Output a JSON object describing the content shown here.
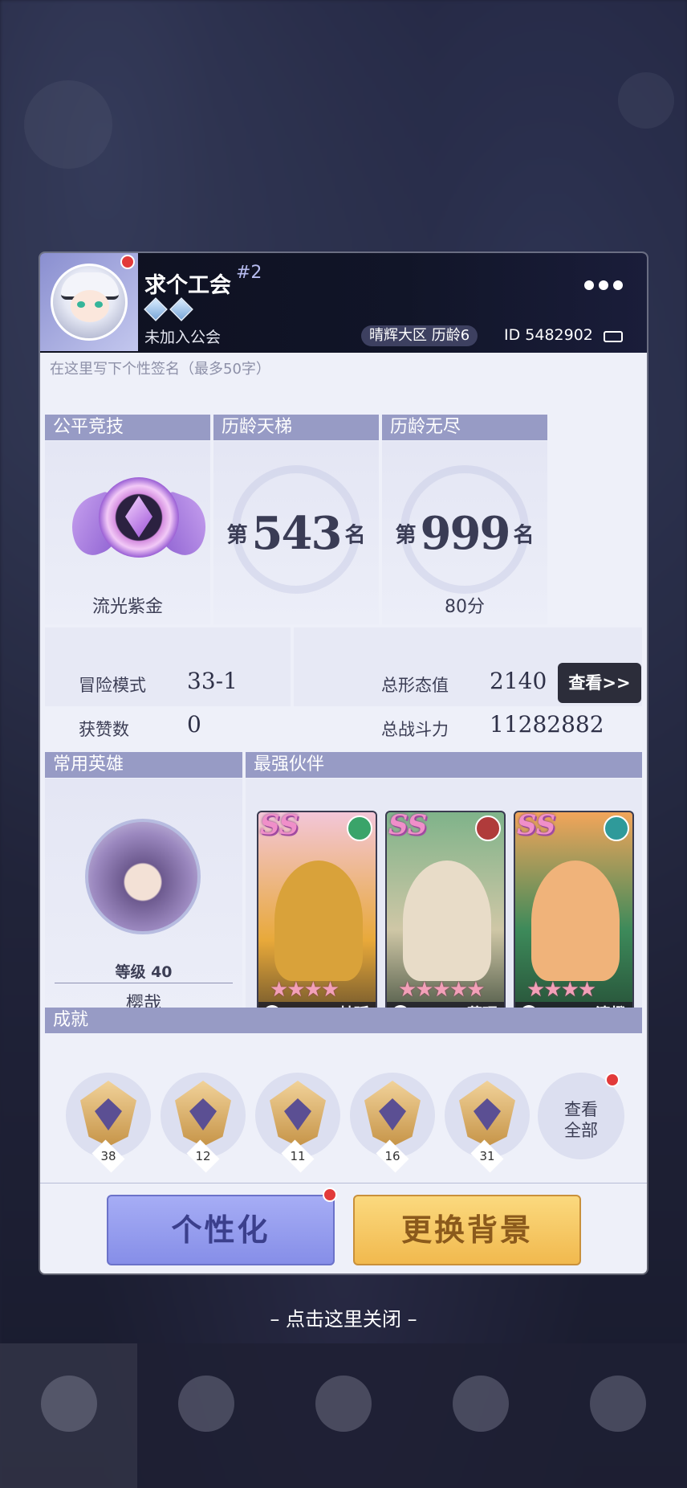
{
  "header": {
    "username": "求个工会",
    "rank_badge": "#2",
    "guild": "未加入公会",
    "region": "晴辉大区  历龄6",
    "player_id": "ID 5482902"
  },
  "signature_placeholder": "在这里写下个性签名（最多50字）",
  "sections": {
    "fair": {
      "title": "公平竞技",
      "rank_name": "流光紫金"
    },
    "ladder": {
      "title": "历龄天梯",
      "prefix": "第",
      "value": "543",
      "suffix": "名"
    },
    "endless": {
      "title": "历龄无尽",
      "prefix": "第",
      "value": "999",
      "suffix": "名",
      "score": "80分"
    }
  },
  "stats": {
    "adventure_label": "冒险模式",
    "adventure_value": "33-1",
    "likes_label": "获赞数",
    "likes_value": "0",
    "form_label": "总形态值",
    "form_value": "2140",
    "power_label": "总战斗力",
    "power_value": "11282882",
    "view_button": "查看>>"
  },
  "hero": {
    "title": "常用英雄",
    "level": "等级 40",
    "name": "樱哉"
  },
  "partners": {
    "title": "最强伙伴",
    "items": [
      {
        "grade": "SS",
        "name": "赫廷",
        "stars": "★★★★",
        "color": "#e8a93a"
      },
      {
        "grade": "SS",
        "name": "藏理",
        "stars": "★★★★★",
        "color": "#6f9d7a"
      },
      {
        "grade": "SS",
        "name": "清橙",
        "stars": "★★★★",
        "color": "#3d8a5a"
      }
    ]
  },
  "achievements": {
    "title": "成就",
    "items": [
      {
        "count": "38"
      },
      {
        "count": "12"
      },
      {
        "count": "11"
      },
      {
        "count": "16"
      },
      {
        "count": "31"
      }
    ],
    "view_all_line1": "查看",
    "view_all_line2": "全部"
  },
  "buttons": {
    "personalize": "个性化",
    "change_bg": "更换背景"
  },
  "close_hint": "– 点击这里关闭 –",
  "colors": {
    "section_header": "#979bc5",
    "card_bg": "#eef0f9",
    "accent_red": "#e23a3a"
  }
}
